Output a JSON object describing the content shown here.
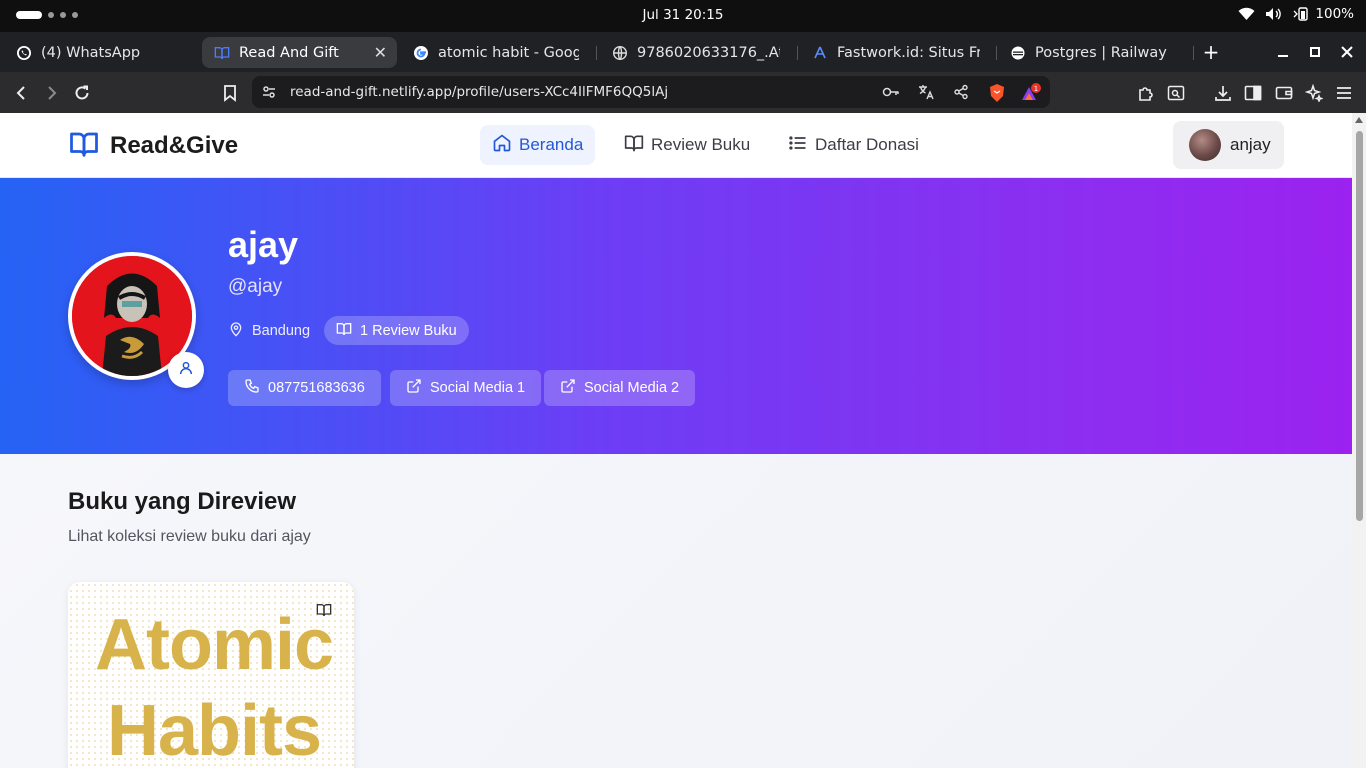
{
  "os": {
    "clock": "Jul 31  20:15",
    "battery": "100%"
  },
  "browser": {
    "tabs": [
      {
        "title": "(4) WhatsApp",
        "icon": "whatsapp-icon"
      },
      {
        "title": "Read And Gift",
        "icon": "book-open-icon",
        "active": true
      },
      {
        "title": "atomic habit - Google",
        "icon": "google-icon"
      },
      {
        "title": "9786020633176_.Ato",
        "icon": "globe-icon"
      },
      {
        "title": "Fastwork.id: Situs Free",
        "icon": "fastwork-icon"
      },
      {
        "title": "Postgres | Railway",
        "icon": "railway-icon"
      }
    ],
    "url": "read-and-gift.netlify.app/profile/users-XCc4IlFMF6QQ5lAj",
    "notification_count": "1"
  },
  "site": {
    "brand": "Read&Give",
    "nav": [
      {
        "label": "Beranda",
        "icon": "home-icon",
        "active": true
      },
      {
        "label": "Review Buku",
        "icon": "book-open-icon"
      },
      {
        "label": "Daftar Donasi",
        "icon": "list-icon"
      }
    ],
    "current_user": "anjay"
  },
  "profile": {
    "name": "ajay",
    "handle": "@ajay",
    "location": "Bandung",
    "review_count_label": "1 Review Buku",
    "phone": "087751683636",
    "social_1": "Social Media 1",
    "social_2": "Social Media 2"
  },
  "reviews": {
    "title": "Buku yang Direview",
    "subtitle": "Lihat koleksi review buku dari ajay",
    "books": [
      {
        "cover_word_1": "Atomic",
        "cover_word_2": "Habits"
      }
    ]
  },
  "colors": {
    "brand_blue": "#2457d6",
    "hero_start": "#2563f5",
    "hero_end": "#9b22f0",
    "cover_gold": "#d8b24a"
  }
}
